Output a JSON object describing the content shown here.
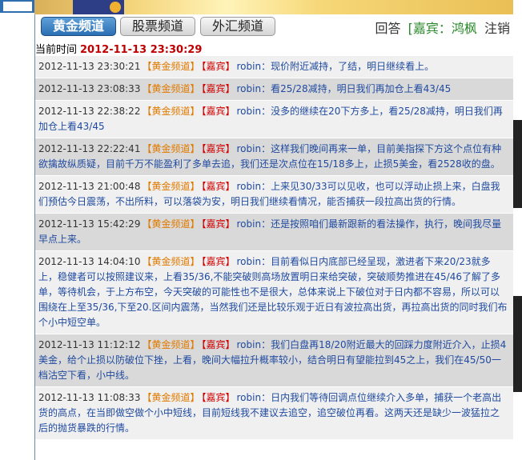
{
  "channels": [
    {
      "label": "黄金频道",
      "active": true
    },
    {
      "label": "股票频道",
      "active": false
    },
    {
      "label": "外汇频道",
      "active": false
    }
  ],
  "top_links": {
    "reply": "回答",
    "guest": "[嘉宾：鸿枫",
    "logout": "注销"
  },
  "current_time": {
    "label": "当前时间",
    "value": "2012-11-13 23:30:29"
  },
  "messages": [
    {
      "time": "2012-11-13 23:30:21",
      "channel": "【黄金频道】",
      "role": "【嘉宾】",
      "user": "robin",
      "text": "：现价附近减持，了结，明日继续看上。"
    },
    {
      "time": "2012-11-13 23:08:33",
      "channel": "【黄金频道】",
      "role": "【嘉宾】",
      "user": "robin",
      "text": "：看25/28减持，明日我们再加仓上看43/45"
    },
    {
      "time": "2012-11-13 22:38:22",
      "channel": "【黄金频道】",
      "role": "【嘉宾】",
      "user": "robin",
      "text": "：没多的继续在20下方多上，看25/28减持，明日我们再加仓上看43/45"
    },
    {
      "time": "2012-11-13 22:22:41",
      "channel": "【黄金频道】",
      "role": "【嘉宾】",
      "user": "robin",
      "text": "：这样我们晚间再来一单，目前美指探下方这个点位有种欲擒故纵质疑，目前千万不能盈利了多单去追，我们还是次点位在15/18多上，止损5美金，看2528收的盘。"
    },
    {
      "time": "2012-11-13 21:00:48",
      "channel": "【黄金频道】",
      "role": "【嘉宾】",
      "user": "robin",
      "text": "：上来见30/33可以见收，也可以浮动止损上来，白盘我们预估今日震荡，不出所料，可以落袋为安，明日我们继续看情况，能否捕获一段拉高出货的行情。"
    },
    {
      "time": "2012-11-13 15:42:29",
      "channel": "【黄金频道】",
      "role": "【嘉宾】",
      "user": "robin",
      "text": "：还是按照咱们最新跟新的看法操作，执行，晚间我尽量早点上来。"
    },
    {
      "time": "2012-11-13 14:04:10",
      "channel": "【黄金频道】",
      "role": "【嘉宾】",
      "user": "robin",
      "text": "：目前看似日内底部已经呈现，激进者下来20/23就多上，稳健者可以按照建议来，上看35/36,不能突破则高场放置明日来给突破，突破顺势推进在45/46了解了多单，等待机会，于上方布空，今天突破的可能性也不是很大，总体来说上下破位对于日内都不容易，所以可以围绕在上至35/36,下至20.区间内震荡，当然我们还是比较乐观于近日有波拉高出货，再拉高出货的同时我们布个小中短空单。"
    },
    {
      "time": "2012-11-13 11:12:12",
      "channel": "【黄金频道】",
      "role": "【嘉宾】",
      "user": "robin",
      "text": "：我们白盘再18/20附近最大的回踩力度附近介入，止损4美金，给个止损以防破位下挫，上看，晚间大幅拉升概率较小，结合明日有望能拉到45之上，我们在45/50一档沽空下看，小中线。"
    },
    {
      "time": "2012-11-13 11:08:33",
      "channel": "【黄金频道】",
      "role": "【嘉宾】",
      "user": "robin",
      "text": "：日内我们等待回调点位继续介入多单，捕获一个老高出货的高点，在当即做空做个小中短线，目前短线我不建议去追空，追空破位再看。这两天还是缺少一波猛拉之后的抛货暴跌的行情。"
    }
  ]
}
